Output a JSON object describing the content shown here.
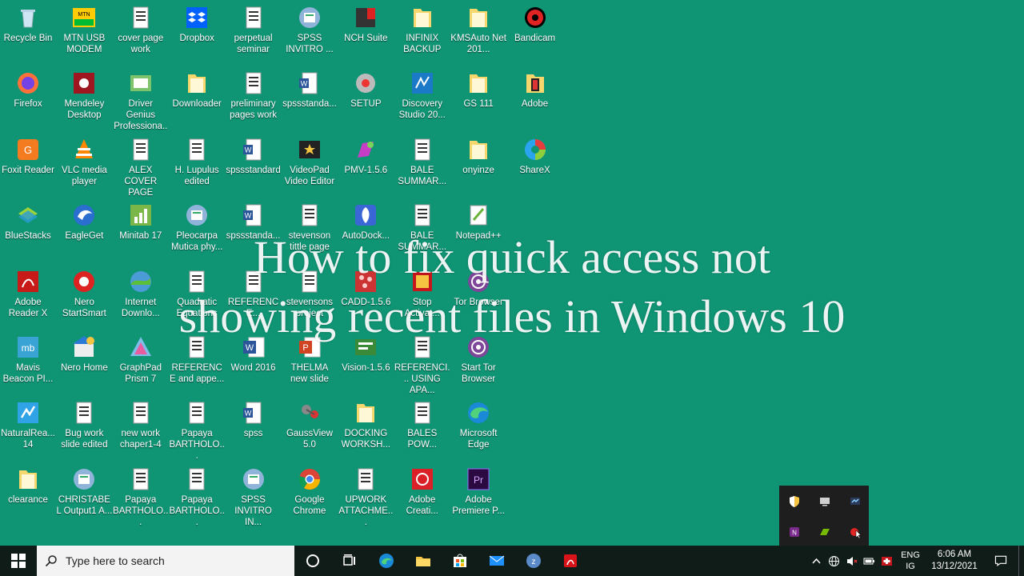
{
  "desktop": {
    "icons": [
      {
        "label": "Recycle Bin",
        "icon": "recycle-bin-icon"
      },
      {
        "label": "MTN USB MODEM",
        "icon": "mtn-modem-icon"
      },
      {
        "label": "cover page work",
        "icon": "document-icon"
      },
      {
        "label": "Dropbox",
        "icon": "dropbox-icon"
      },
      {
        "label": "perpetual seminar",
        "icon": "document-icon"
      },
      {
        "label": "SPSS INVITRO ...",
        "icon": "spss-icon"
      },
      {
        "label": "NCH Suite",
        "icon": "nch-suite-icon"
      },
      {
        "label": "INFINIX BACKUP",
        "icon": "folder-icon"
      },
      {
        "label": "KMSAuto Net 201...",
        "icon": "folder-icon"
      },
      {
        "label": "Bandicam",
        "icon": "bandicam-icon"
      },
      {
        "label": "Firefox",
        "icon": "firefox-icon"
      },
      {
        "label": "Mendeley Desktop",
        "icon": "mendeley-icon"
      },
      {
        "label": "Driver Genius Professiona...",
        "icon": "driver-genius-icon"
      },
      {
        "label": "Downloader",
        "icon": "folder-icon"
      },
      {
        "label": "preliminary pages work",
        "icon": "document-icon"
      },
      {
        "label": "spssstanda...",
        "icon": "word-doc-icon"
      },
      {
        "label": "SETUP",
        "icon": "setup-icon"
      },
      {
        "label": "Discovery Studio 20...",
        "icon": "discovery-studio-icon"
      },
      {
        "label": "GS 111",
        "icon": "folder-icon"
      },
      {
        "label": "Adobe",
        "icon": "adobe-folder-icon"
      },
      {
        "label": "Foxit Reader",
        "icon": "foxit-icon"
      },
      {
        "label": "VLC media player",
        "icon": "vlc-icon"
      },
      {
        "label": "ALEX COVER PAGE",
        "icon": "document-icon"
      },
      {
        "label": "H. Lupulus edited",
        "icon": "document-icon"
      },
      {
        "label": "spssstandard",
        "icon": "word-doc-icon"
      },
      {
        "label": "VideoPad Video Editor",
        "icon": "videopad-icon"
      },
      {
        "label": "PMV-1.5.6",
        "icon": "pmv-icon"
      },
      {
        "label": "BALE SUMMAR...",
        "icon": "document-icon"
      },
      {
        "label": "onyinze",
        "icon": "folder-icon"
      },
      {
        "label": "ShareX",
        "icon": "sharex-icon"
      },
      {
        "label": "BlueStacks",
        "icon": "bluestacks-icon"
      },
      {
        "label": "EagleGet",
        "icon": "eagleget-icon"
      },
      {
        "label": "Minitab 17",
        "icon": "minitab-icon"
      },
      {
        "label": "Pleocarpa Mutica phy...",
        "icon": "spss-icon"
      },
      {
        "label": "spssstanda...",
        "icon": "word-doc-icon"
      },
      {
        "label": "stevenson tittle page",
        "icon": "document-icon"
      },
      {
        "label": "AutoDock...",
        "icon": "autodock-icon"
      },
      {
        "label": "BALE SUMMAR...",
        "icon": "document-icon"
      },
      {
        "label": "Notepad++",
        "icon": "notepadpp-icon"
      },
      {
        "label": "",
        "icon": ""
      },
      {
        "label": "Adobe Reader X",
        "icon": "adobe-reader-icon"
      },
      {
        "label": "Nero StartSmart",
        "icon": "nero-icon"
      },
      {
        "label": "Internet Downlo...",
        "icon": "idm-icon"
      },
      {
        "label": "Quadratic Equations",
        "icon": "document-icon"
      },
      {
        "label": "REFERENCE...",
        "icon": "document-icon"
      },
      {
        "label": "stevensons project",
        "icon": "document-icon"
      },
      {
        "label": "CADD-1.5.6",
        "icon": "cadd-icon"
      },
      {
        "label": "Stop Activat...",
        "icon": "stop-icon"
      },
      {
        "label": "Tor Browser",
        "icon": "tor-icon"
      },
      {
        "label": "",
        "icon": ""
      },
      {
        "label": "Mavis Beacon PI...",
        "icon": "mavis-icon"
      },
      {
        "label": "Nero Home",
        "icon": "nero-home-icon"
      },
      {
        "label": "GraphPad Prism 7",
        "icon": "graphpad-icon"
      },
      {
        "label": "REFERENCE and appe...",
        "icon": "document-icon"
      },
      {
        "label": "Word 2016",
        "icon": "word-icon"
      },
      {
        "label": "THELMA new slide",
        "icon": "powerpoint-icon"
      },
      {
        "label": "Vision-1.5.6",
        "icon": "vision-icon"
      },
      {
        "label": "REFERENCI... USING APA...",
        "icon": "document-icon"
      },
      {
        "label": "Start Tor Browser",
        "icon": "tor-icon"
      },
      {
        "label": "",
        "icon": ""
      },
      {
        "label": "NaturalRea... 14",
        "icon": "naturalreader-icon"
      },
      {
        "label": "Bug work slide edited",
        "icon": "document-icon"
      },
      {
        "label": "new work chaper1-4",
        "icon": "document-icon"
      },
      {
        "label": "Papaya BARTHOLO...",
        "icon": "document-icon"
      },
      {
        "label": "spss",
        "icon": "word-doc-icon"
      },
      {
        "label": "GaussView 5.0",
        "icon": "gaussview-icon"
      },
      {
        "label": "DOCKING WORKSH...",
        "icon": "folder-icon"
      },
      {
        "label": "BALES POW...",
        "icon": "document-icon"
      },
      {
        "label": "Microsoft Edge",
        "icon": "edge-icon"
      },
      {
        "label": "",
        "icon": ""
      },
      {
        "label": "clearance",
        "icon": "folder-icon"
      },
      {
        "label": "CHRISTABEL Output1 A...",
        "icon": "spss-icon"
      },
      {
        "label": "Papaya BARTHOLO...",
        "icon": "document-icon"
      },
      {
        "label": "Papaya BARTHOLO...",
        "icon": "document-icon"
      },
      {
        "label": "SPSS INVITRO IN...",
        "icon": "spss-icon"
      },
      {
        "label": "Google Chrome",
        "icon": "chrome-icon"
      },
      {
        "label": "UPWORK ATTACHME...",
        "icon": "document-icon"
      },
      {
        "label": "Adobe Creati...",
        "icon": "adobe-cc-icon"
      },
      {
        "label": "Adobe Premiere P...",
        "icon": "premiere-icon"
      },
      {
        "label": "",
        "icon": ""
      }
    ]
  },
  "overlay": {
    "line1": "How to fix quick access not",
    "line2": "showing recent files in Windows 10"
  },
  "tray_flyout": {
    "icons": [
      "security-shield-icon",
      "display-icon",
      "network-monitor-icon",
      "audio-app-icon",
      "nvidia-icon",
      "bandicam-tray-icon"
    ]
  },
  "taskbar": {
    "search_placeholder": "Type here to search",
    "pinned": [
      "cortana-icon",
      "task-view-icon",
      "edge-icon",
      "file-explorer-icon",
      "store-icon",
      "mail-icon",
      "app-icon",
      "acrobat-icon"
    ],
    "language_line1": "ENG",
    "language_line2": "IG",
    "time": "6:06 AM",
    "date": "13/12/2021"
  }
}
